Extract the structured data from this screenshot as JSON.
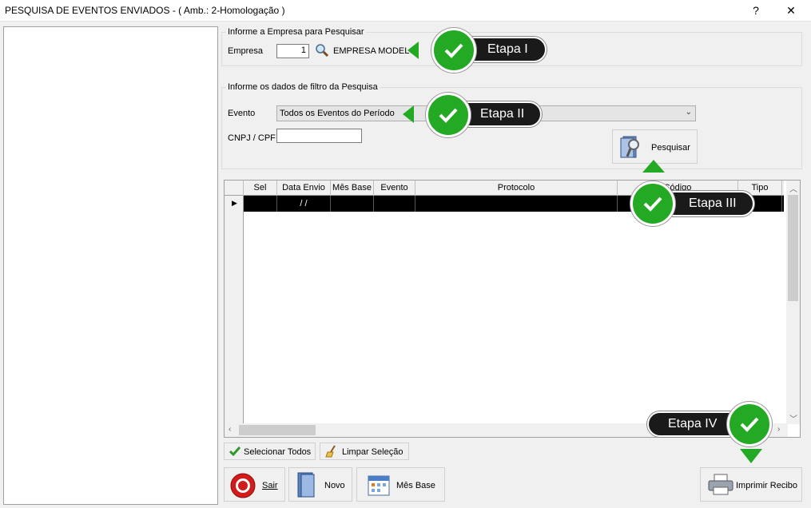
{
  "window": {
    "title": "PESQUISA DE EVENTOS ENVIADOS - ( Amb.: 2-Homologação )",
    "help": "?",
    "close": "✕"
  },
  "empresa_group": {
    "title": "Informe a Empresa para Pesquisar",
    "label": "Empresa",
    "value": "1",
    "name": "EMPRESA MODELO"
  },
  "filtro_group": {
    "title": "Informe os dados de filtro da Pesquisa",
    "evento_label": "Evento",
    "evento_value": "Todos os Eventos do Período",
    "cnpj_label": "CNPJ / CPF",
    "cnpj_value": ""
  },
  "pesquisar_label": "Pesquisar",
  "grid": {
    "columns": [
      "Sel",
      "Data Envio",
      "Mês Base",
      "Evento",
      "Protocolo",
      "Código",
      "Tipo"
    ],
    "row": [
      "",
      " / /",
      "",
      "",
      "",
      "",
      ""
    ],
    "row_indicator": "▶"
  },
  "buttons": {
    "selecionar_todos": "Selecionar Todos",
    "limpar_selecao": "Limpar Seleção",
    "sair": "Sair",
    "novo": "Novo",
    "mes_base": "Mês Base",
    "imprimir_recibo": "Imprimir Recibo"
  },
  "callouts": {
    "etapa1": "Etapa I",
    "etapa2": "Etapa II",
    "etapa3": "Etapa III",
    "etapa4": "Etapa IV"
  },
  "colors": {
    "check_green": "#23a924",
    "callout_dark": "#1a1a1a"
  }
}
